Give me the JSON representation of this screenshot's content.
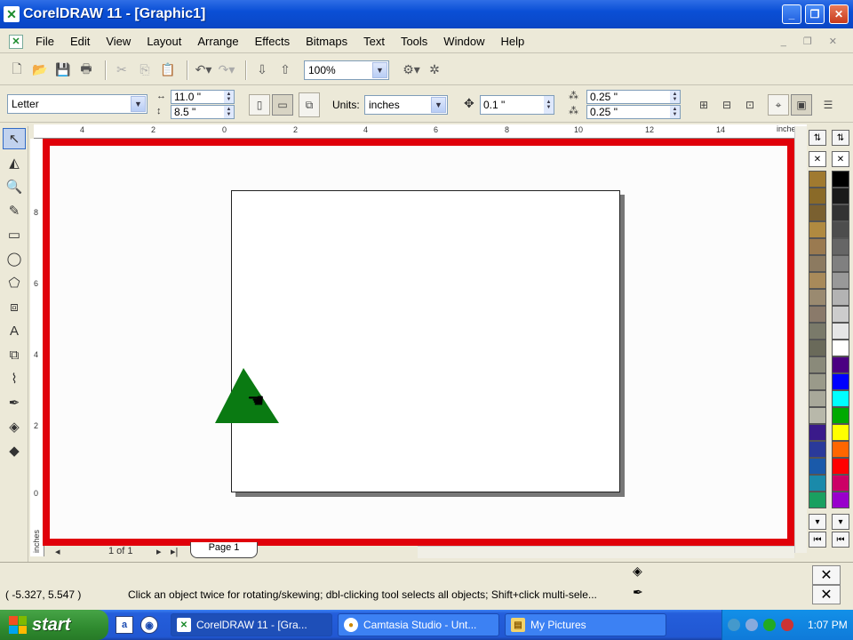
{
  "window": {
    "title": "CorelDRAW 11 - [Graphic1]",
    "app_icon": "coreldraw-icon",
    "buttons": [
      "_",
      "❐",
      "✕"
    ]
  },
  "menu": [
    {
      "label": "File"
    },
    {
      "label": "Edit"
    },
    {
      "label": "View"
    },
    {
      "label": "Layout"
    },
    {
      "label": "Arrange"
    },
    {
      "label": "Effects"
    },
    {
      "label": "Bitmaps"
    },
    {
      "label": "Text"
    },
    {
      "label": "Tools"
    },
    {
      "label": "Window"
    },
    {
      "label": "Help"
    }
  ],
  "mdi_controls": "_ ❐ ✕",
  "standard_toolbar": {
    "zoom": "100%"
  },
  "property_bar": {
    "paper": "Letter",
    "width": "11.0 \"",
    "height": "8.5 \"",
    "units_label": "Units:",
    "units_value": "inches",
    "nudge": "0.1 \"",
    "dup_x": "0.25 \"",
    "dup_y": "0.25 \""
  },
  "rulers": {
    "unit": "inches",
    "h_ticks": [
      "4",
      "2",
      "0",
      "2",
      "4",
      "6",
      "8",
      "10",
      "12",
      "14"
    ],
    "v_ticks": [
      "8",
      "6",
      "4",
      "2",
      "0"
    ],
    "v_unit": "inches"
  },
  "canvas": {
    "frame_color": "#e0000a",
    "shape": "triangle",
    "shape_color": "#0a7a12"
  },
  "page_nav": {
    "counter": "1 of 1",
    "tab": "Page 1"
  },
  "status": {
    "coords": "( -5.327, 5.547 )",
    "hint": "Click an object twice for rotating/skewing; dbl-clicking tool selects all objects; Shift+click multi-sele..."
  },
  "palette": [
    "#a07a30",
    "#8a6a28",
    "#7a6030",
    "#b08a40",
    "#9a7a50",
    "#8c7a60",
    "#a88a5a",
    "#9a8a70",
    "#8a7a6a",
    "#7a7a6a",
    "#6a6a5a",
    "#8a8a7a",
    "#9a9a8a",
    "#a8a89a",
    "#b8b8aa",
    "#3a1a8a",
    "#2a3a9a",
    "#1a5aaa",
    "#1a8aaa",
    "#1aa060",
    "#7aa01a",
    "#c0a01a",
    "#d06a1a",
    "#c03a1a",
    "#b01a4a",
    "#8a1a6a"
  ],
  "palette_right": [
    "#000000",
    "#1a1a1a",
    "#333333",
    "#4d4d4d",
    "#666666",
    "#808080",
    "#999999",
    "#b3b3b3",
    "#cccccc",
    "#e6e6e6",
    "#ffffff",
    "#4b0082",
    "#0000ff",
    "#00ffff",
    "#00aa00",
    "#ffff00",
    "#ff6600",
    "#ff0000",
    "#cc0066",
    "#9900cc"
  ],
  "taskbar": {
    "start": "start",
    "tasks": [
      {
        "label": "CorelDRAW 11 - [Gra...",
        "icon": "coreldraw-icon"
      },
      {
        "label": "Camtasia Studio - Unt...",
        "icon": "camtasia-icon"
      },
      {
        "label": "My Pictures",
        "icon": "folder-icon"
      }
    ],
    "clock": "1:07 PM"
  }
}
